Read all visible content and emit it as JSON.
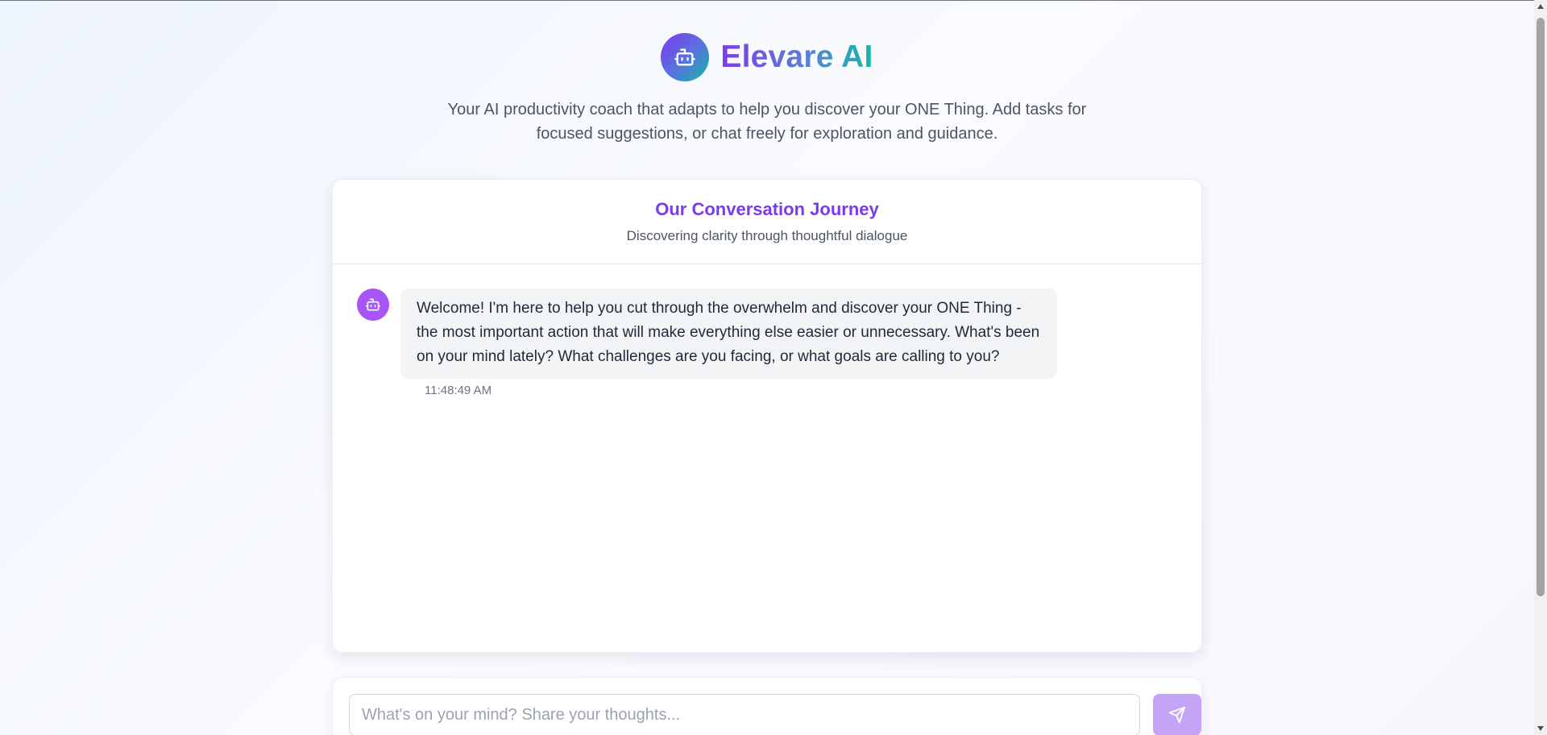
{
  "app": {
    "title": "Elevare AI",
    "tagline": "Your AI productivity coach that adapts to help you discover your ONE Thing. Add tasks for focused suggestions, or chat freely for exploration and guidance.",
    "logo_icon": "robot-icon"
  },
  "conversation": {
    "title": "Our Conversation Journey",
    "subtitle": "Discovering clarity through thoughtful dialogue",
    "messages": [
      {
        "sender": "bot",
        "avatar_icon": "robot-icon",
        "text": "Welcome! I'm here to help you cut through the overwhelm and discover your ONE Thing - the most important action that will make everything else easier or unnecessary. What's been on your mind lately? What challenges are you facing, or what goals are calling to you?",
        "timestamp": "11:48:49 AM"
      }
    ]
  },
  "composer": {
    "placeholder": "What's on your mind? Share your thoughts...",
    "value": "",
    "send_icon": "send-icon"
  },
  "colors": {
    "accent": "#7c3aed",
    "teal": "#14b8a6",
    "bot_avatar": "#a855f7",
    "send_button": "#c4a4f7"
  }
}
